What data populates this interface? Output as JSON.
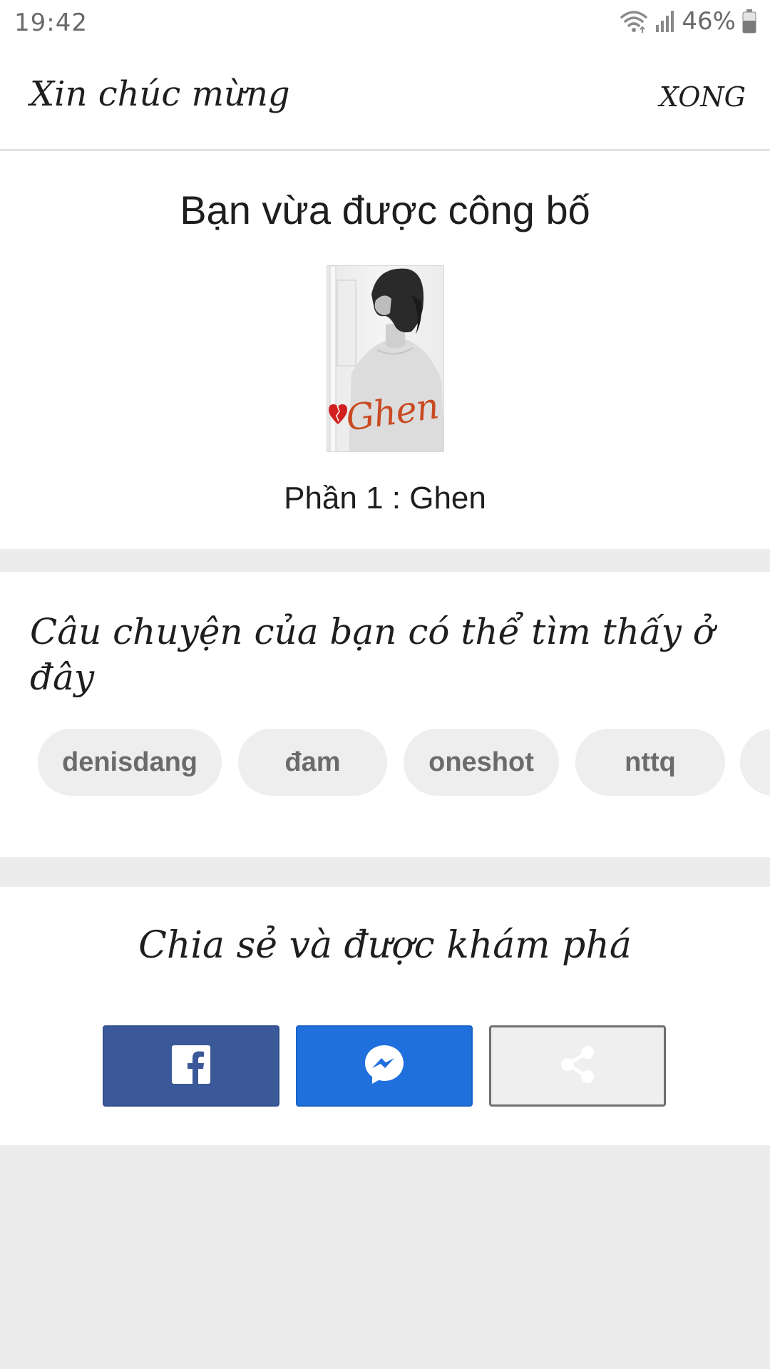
{
  "status_bar": {
    "time": "19:42",
    "battery": "46%",
    "icons": [
      "wifi-icon",
      "signal-icon",
      "battery-icon"
    ]
  },
  "header": {
    "title": "Xin chúc mừng",
    "done_label": "XONG"
  },
  "published": {
    "title": "Bạn vừa được công bố",
    "cover_title": "Ghen",
    "part_title": "Phần 1 : Ghen"
  },
  "tags": {
    "heading": "Câu chuyện của bạn có thể tìm thấy ở đây",
    "items": [
      "denisdang",
      "đam",
      "oneshot",
      "nttq",
      ""
    ]
  },
  "share": {
    "heading": "Chia sẻ và được khám phá",
    "buttons": [
      {
        "icon": "facebook-icon",
        "color": "#3b5998"
      },
      {
        "icon": "messenger-icon",
        "color": "#1f6fdc"
      },
      {
        "icon": "share-icon",
        "color": "#efefef"
      }
    ]
  },
  "colors": {
    "background": "#ececec",
    "tag_background": "#eeeeee",
    "tag_text": "#6b6b6b",
    "cover_script": "#c94a22",
    "heart": "#d21f1f"
  }
}
